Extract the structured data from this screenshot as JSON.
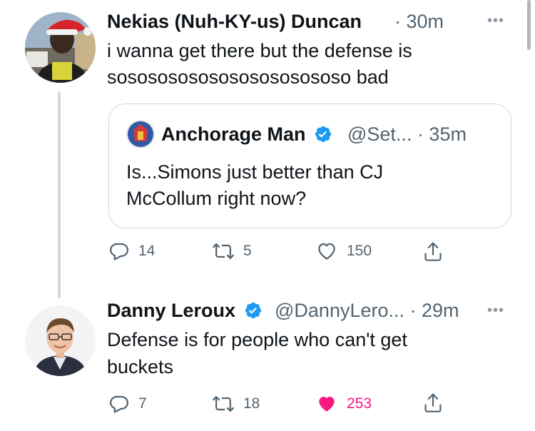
{
  "tweet1": {
    "name": "Nekias (Nuh-KY-us) Duncan",
    "time": "· 30m",
    "text_line1": "i wanna get there but the defense is",
    "text_line2": "sosososososososososososo bad",
    "more_icon": "more-horizontal-icon"
  },
  "quote": {
    "name": "Anchorage Man",
    "handle": "@Set... · 35m",
    "text_line1": "Is...Simons just better than CJ",
    "text_line2": "McCollum right now?",
    "verified_icon": "verified-badge-icon"
  },
  "tweet1_actions": {
    "replies": "14",
    "retweets": "5",
    "likes": "150"
  },
  "tweet2": {
    "name": "Danny Leroux",
    "handle": "@DannyLero... · 29m",
    "text_line1": "Defense is for people who can't get",
    "text_line2": "buckets",
    "verified_icon": "verified-badge-icon"
  },
  "tweet2_actions": {
    "replies": "7",
    "retweets": "18",
    "likes": "253"
  },
  "colors": {
    "text": "#0f1419",
    "muted": "#536471",
    "verified": "#1d9bf0",
    "like": "#f91880",
    "border": "#cfd9de"
  }
}
